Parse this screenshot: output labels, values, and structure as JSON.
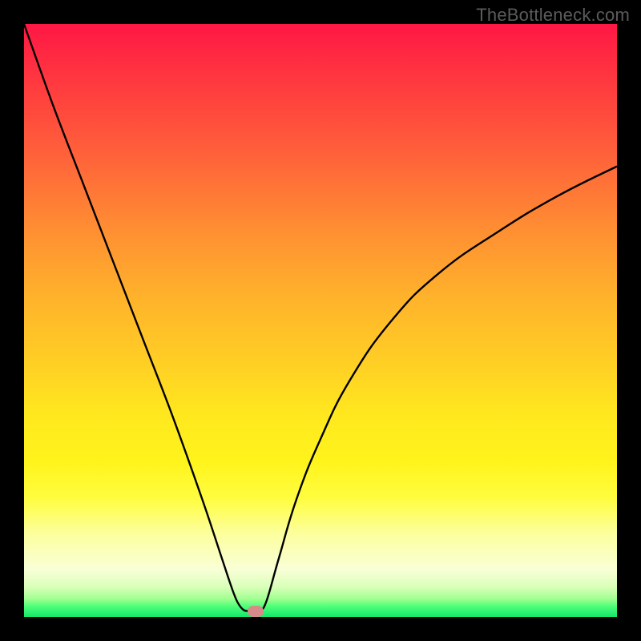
{
  "attribution": "TheBottleneck.com",
  "chart_data": {
    "type": "line",
    "title": "",
    "xlabel": "",
    "ylabel": "",
    "xlim": [
      0,
      100
    ],
    "ylim": [
      0,
      100
    ],
    "curve": {
      "minimum_x": 38,
      "left_branch": [
        {
          "x": 0,
          "y": 100
        },
        {
          "x": 5,
          "y": 86
        },
        {
          "x": 10,
          "y": 73
        },
        {
          "x": 15,
          "y": 60
        },
        {
          "x": 20,
          "y": 47
        },
        {
          "x": 25,
          "y": 34
        },
        {
          "x": 30,
          "y": 20
        },
        {
          "x": 33,
          "y": 11
        },
        {
          "x": 35,
          "y": 5
        },
        {
          "x": 36,
          "y": 2.5
        },
        {
          "x": 37,
          "y": 1.2
        },
        {
          "x": 38,
          "y": 1
        },
        {
          "x": 40,
          "y": 1
        }
      ],
      "right_branch": [
        {
          "x": 40,
          "y": 1
        },
        {
          "x": 41,
          "y": 3
        },
        {
          "x": 43,
          "y": 10
        },
        {
          "x": 46,
          "y": 20
        },
        {
          "x": 50,
          "y": 30
        },
        {
          "x": 55,
          "y": 40
        },
        {
          "x": 62,
          "y": 50
        },
        {
          "x": 70,
          "y": 58
        },
        {
          "x": 80,
          "y": 65
        },
        {
          "x": 90,
          "y": 71
        },
        {
          "x": 100,
          "y": 76
        }
      ]
    },
    "marker": {
      "x": 39,
      "y": 1
    },
    "gradient_stops": [
      {
        "pos": 0,
        "color": "#ff1745"
      },
      {
        "pos": 0.5,
        "color": "#ffd124"
      },
      {
        "pos": 0.8,
        "color": "#fffd40"
      },
      {
        "pos": 1.0,
        "color": "#12e86a"
      }
    ]
  }
}
